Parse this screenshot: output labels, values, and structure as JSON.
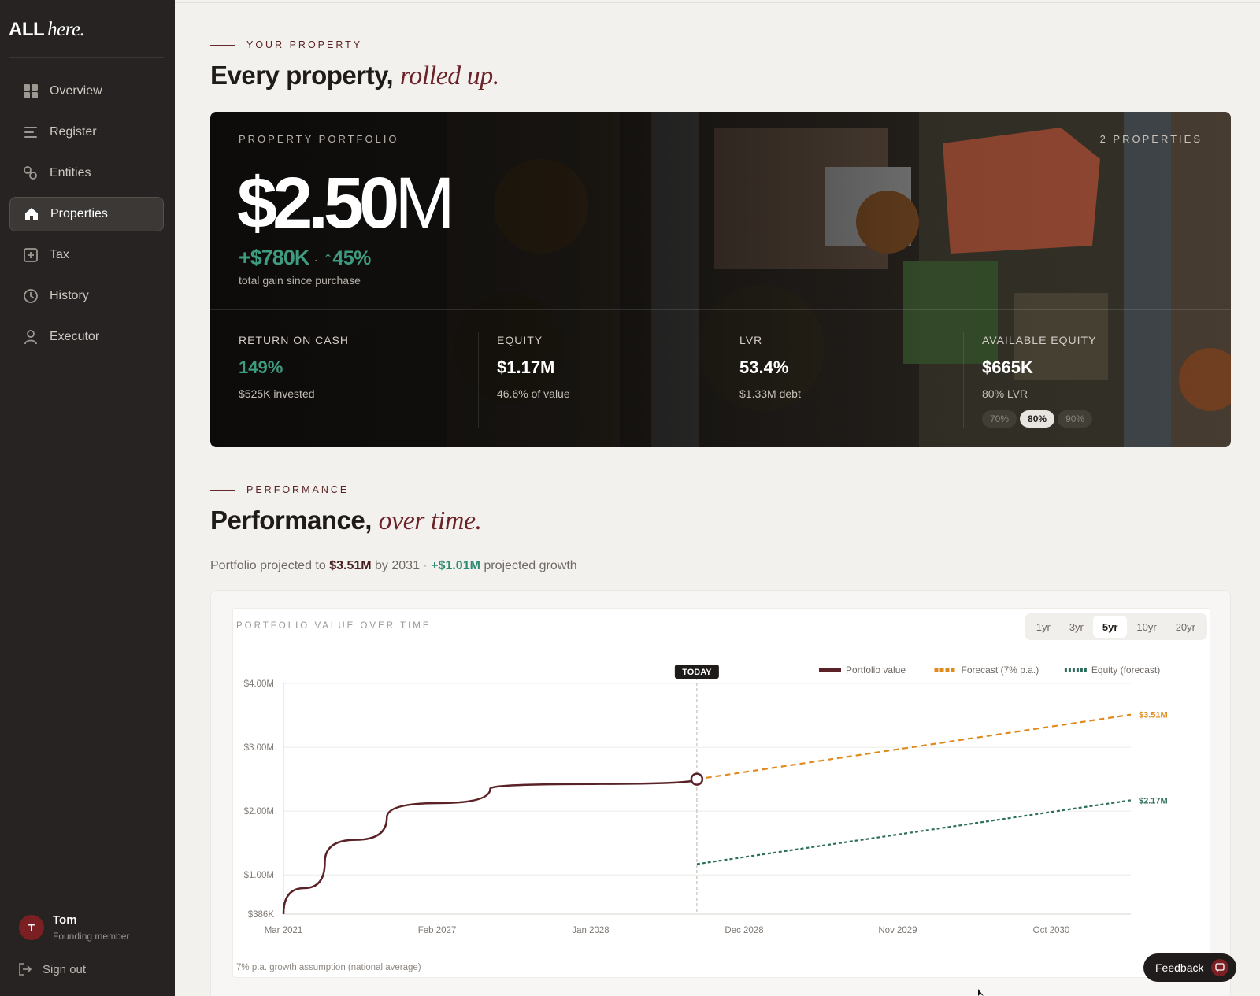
{
  "app": {
    "logo_main": "ALL",
    "logo_italic": "here."
  },
  "sidebar": {
    "items": [
      {
        "label": "Overview",
        "icon": "grid-icon"
      },
      {
        "label": "Register",
        "icon": "list-icon"
      },
      {
        "label": "Entities",
        "icon": "link-icon"
      },
      {
        "label": "Properties",
        "icon": "home-icon",
        "active": true
      },
      {
        "label": "Tax",
        "icon": "plus-square-icon"
      },
      {
        "label": "History",
        "icon": "clock-icon"
      },
      {
        "label": "Executor",
        "icon": "person-icon"
      }
    ],
    "user": {
      "initial": "T",
      "name": "Tom",
      "role": "Founding member"
    },
    "sign_out": "Sign out"
  },
  "property_section": {
    "eyebrow": "YOUR PROPERTY",
    "heading": "Every property,",
    "heading_accent": "rolled up."
  },
  "hero": {
    "label": "PROPERTY PORTFOLIO",
    "count": "2 PROPERTIES",
    "value": "$2.50",
    "value_unit": "M",
    "gain": "+$780K",
    "gain_sep": "·",
    "gain_pct": "↑45%",
    "gain_sub": "total gain since purchase",
    "stats": [
      {
        "label": "RETURN ON CASH",
        "value": "149%",
        "sub": "$525K invested",
        "color": "#3e9b80"
      },
      {
        "label": "EQUITY",
        "value": "$1.17M",
        "sub": "46.6% of value"
      },
      {
        "label": "LVR",
        "value": "53.4%",
        "sub": "$1.33M debt"
      },
      {
        "label": "AVAILABLE EQUITY",
        "value": "$665K",
        "sub": "80% LVR"
      }
    ],
    "lvr_options": [
      "70%",
      "80%",
      "90%"
    ],
    "lvr_selected": "80%"
  },
  "performance_section": {
    "eyebrow": "PERFORMANCE",
    "heading": "Performance,",
    "heading_accent": "over time.",
    "subtitle_pre": "Portfolio projected to",
    "subtitle_value": "$3.51M",
    "subtitle_mid": "by 2031",
    "subtitle_sep": "·",
    "subtitle_growth": "+$1.01M",
    "subtitle_post": "projected growth"
  },
  "chart_card": {
    "title": "PORTFOLIO VALUE OVER TIME",
    "ranges": [
      "1yr",
      "3yr",
      "5yr",
      "10yr",
      "20yr"
    ],
    "range_selected": "5yr",
    "today_label": "TODAY",
    "footnote": "7% p.a. growth assumption (national average)"
  },
  "chart_data": {
    "type": "line",
    "x_axis": "date",
    "x_ticks": [
      "Mar 2021",
      "Feb 2027",
      "Jan 2028",
      "Dec 2028",
      "Nov 2029",
      "Oct 2030"
    ],
    "y_ticks": [
      "$386K",
      "$1.00M",
      "$2.00M",
      "$3.00M",
      "$4.00M"
    ],
    "y_tick_values": [
      0.386,
      1.0,
      2.0,
      3.0,
      4.0
    ],
    "y_unit": "$M",
    "ylim": [
      0.386,
      4.0
    ],
    "x_range": [
      "2021-03",
      "2031-06"
    ],
    "today": "2026-03",
    "grid": true,
    "legend_position": "top-right",
    "series": [
      {
        "name": "Portfolio value",
        "style": "solid",
        "color": "#5a2226",
        "points": [
          [
            "2021-03",
            0.386
          ],
          [
            "2021-09",
            1.2
          ],
          [
            "2022-06",
            1.9
          ],
          [
            "2023-09",
            2.35
          ],
          [
            "2026-03",
            2.5
          ]
        ]
      },
      {
        "name": "Forecast (7% p.a.)",
        "style": "dashed",
        "color": "#e08a1e",
        "points": [
          [
            "2026-03",
            2.5
          ],
          [
            "2031-06",
            3.51
          ]
        ],
        "end_label": "$3.51M"
      },
      {
        "name": "Equity (forecast)",
        "style": "dotted",
        "color": "#2e6e5c",
        "points": [
          [
            "2026-03",
            1.17
          ],
          [
            "2031-06",
            2.17
          ]
        ],
        "end_label": "$2.17M"
      }
    ]
  },
  "feedback": {
    "label": "Feedback"
  }
}
